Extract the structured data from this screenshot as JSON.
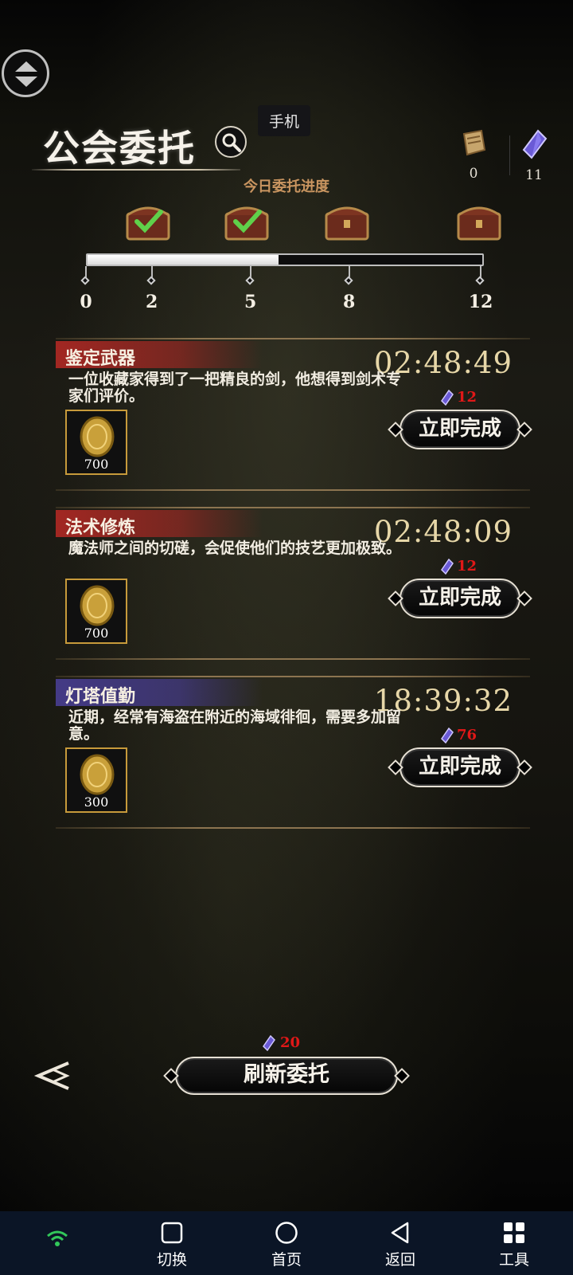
{
  "overlay": {
    "tooltip": "手机"
  },
  "header": {
    "title": "公会委托",
    "currencies": [
      {
        "icon": "scroll-icon",
        "value": "0"
      },
      {
        "icon": "crystal-icon",
        "value": "11"
      }
    ]
  },
  "progress": {
    "label": "今日委托进度",
    "current": 5.8,
    "max": 12,
    "ticks": [
      "0",
      "2",
      "5",
      "8",
      "12"
    ],
    "chests": [
      {
        "claimed": true
      },
      {
        "claimed": true
      },
      {
        "claimed": false
      },
      {
        "claimed": false
      }
    ]
  },
  "tasks": [
    {
      "name": "鉴定武器",
      "description": "一位收藏家得到了一把精良的剑，他想得到剑术专家们评价。",
      "timer": "02:48:49",
      "cost": "12",
      "reward_qty": "700",
      "button": "立即完成",
      "theme": "red"
    },
    {
      "name": "法术修炼",
      "description": "魔法师之间的切磋，会促使他们的技艺更加极致。",
      "timer": "02:48:09",
      "cost": "12",
      "reward_qty": "700",
      "button": "立即完成",
      "theme": "red"
    },
    {
      "name": "灯塔值勤",
      "description": "近期，经常有海盗在附近的海域徘徊，需要多加留意。",
      "timer": "18:39:32",
      "cost": "76",
      "reward_qty": "300",
      "button": "立即完成",
      "theme": "blue"
    }
  ],
  "refresh": {
    "cost": "20",
    "label": "刷新委托"
  },
  "navbar": {
    "items": [
      "切换",
      "首页",
      "返回",
      "工具"
    ]
  },
  "colors": {
    "cost_red": "#e01818",
    "timer_gold": "#e7d7a8",
    "progress_orange": "#c99560",
    "navbar_bg": "#0b1526"
  }
}
